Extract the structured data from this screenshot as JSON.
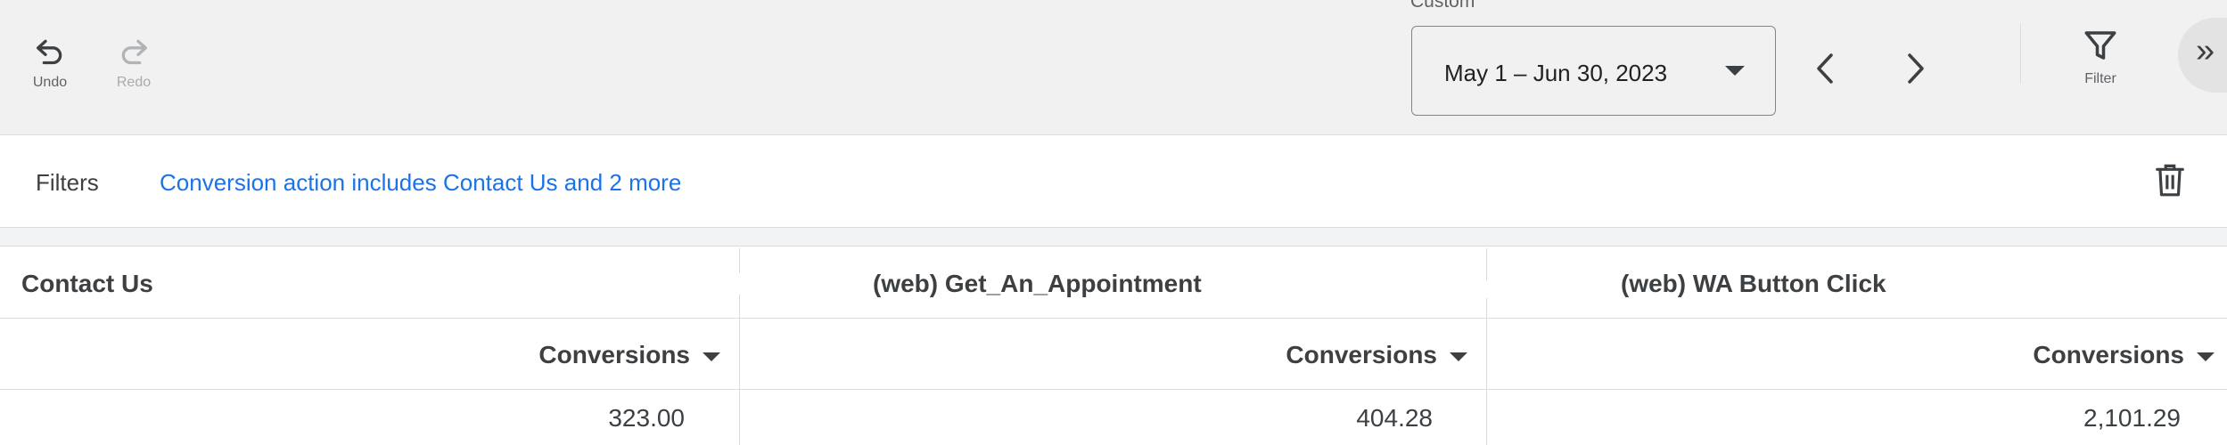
{
  "toolbar": {
    "undo_label": "Undo",
    "redo_label": "Redo",
    "date_caption": "Custom",
    "date_range": "May 1 – Jun 30, 2023",
    "filter_label": "Filter",
    "expand_symbol": "»"
  },
  "filters": {
    "label": "Filters",
    "summary": "Conversion action includes Contact Us and 2 more"
  },
  "table": {
    "columns": [
      {
        "group": "Contact Us",
        "metric": "Conversions",
        "value": "323.00"
      },
      {
        "group": "(web) Get_An_Appointment",
        "metric": "Conversions",
        "value": "404.28"
      },
      {
        "group": "(web) WA Button Click",
        "metric": "Conversions",
        "value": "2,101.29"
      }
    ]
  },
  "colors": {
    "accent_link": "#1a73e8",
    "toolbar_bg": "#f1f1f1",
    "text": "#3c4043"
  },
  "icons": [
    "undo-icon",
    "redo-icon",
    "chevron-left-icon",
    "chevron-right-icon",
    "filter-icon",
    "trash-icon",
    "sort-down-icon"
  ]
}
